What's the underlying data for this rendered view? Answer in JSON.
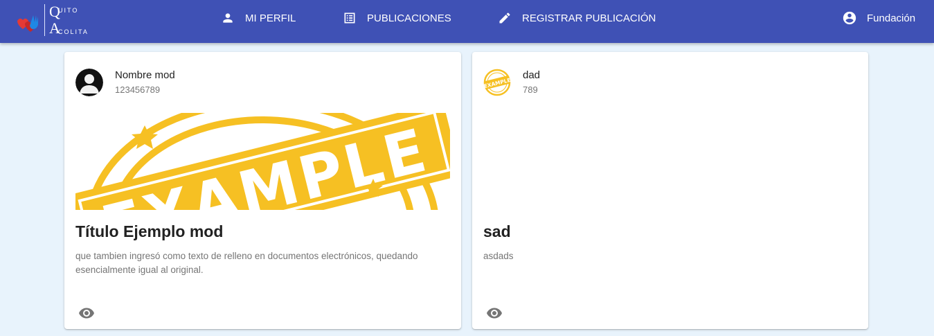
{
  "app": {
    "logo": {
      "line1_initial": "Q",
      "line1_rest": "UITO",
      "line2_initial": "A",
      "line2_rest": "COLITA"
    }
  },
  "nav": {
    "perfil": {
      "label": "MI PERFIL",
      "icon": "person-icon"
    },
    "publicaciones": {
      "label": "PUBLICACIONES",
      "icon": "list-icon"
    },
    "registrar": {
      "label": "REGISTRAR PUBLICACIÓN",
      "icon": "pencil-icon"
    },
    "user": {
      "label": "Fundación",
      "icon": "account-circle-icon"
    }
  },
  "colors": {
    "appbar": "#3f51b5",
    "background": "#e8f3fc",
    "stamp": "#f6c023"
  },
  "posts": [
    {
      "author": "Nombre mod",
      "phone": "123456789",
      "cover_text": "EXAMPLE",
      "title": "Título Ejemplo mod",
      "description": "que tambien ingresó como texto de relleno en documentos electrónicos, quedando esencialmente igual al original.",
      "action_icon": "eye-icon"
    },
    {
      "author": "dad",
      "phone": "789",
      "avatar_text": "EXAMPLE",
      "title": "sad",
      "description": "asdads",
      "action_icon": "eye-icon"
    }
  ]
}
